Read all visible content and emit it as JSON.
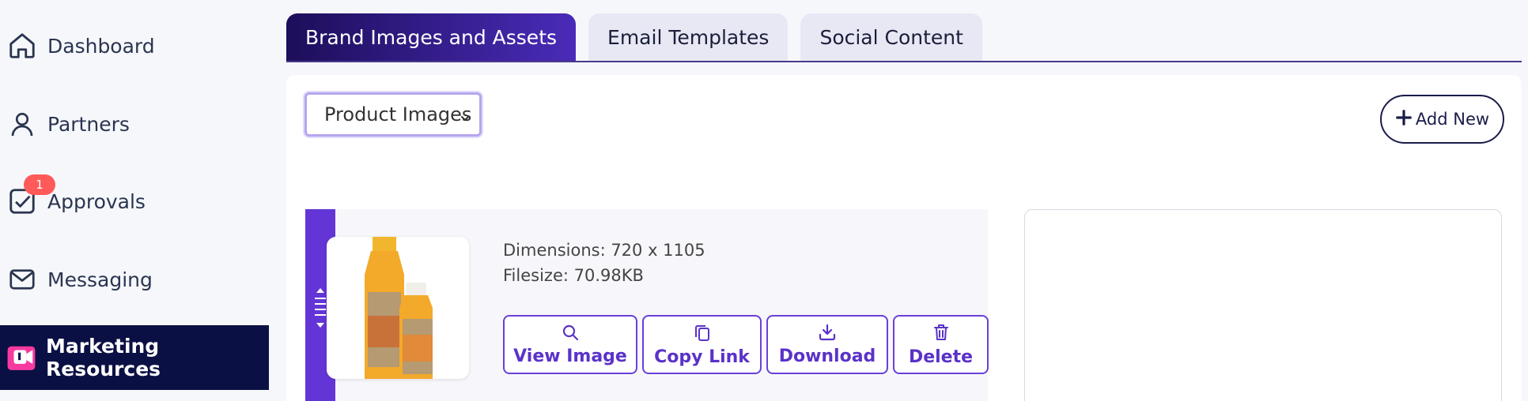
{
  "sidebar": {
    "items": [
      {
        "label": "Dashboard",
        "icon": "home-icon"
      },
      {
        "label": "Partners",
        "icon": "user-icon"
      },
      {
        "label": "Approvals",
        "icon": "checkbox-icon",
        "badge": "1"
      },
      {
        "label": "Messaging",
        "icon": "mail-icon"
      },
      {
        "label": "Marketing Resources",
        "icon": "marketing-icon",
        "active": true
      }
    ]
  },
  "tabs": [
    {
      "label": "Brand Images and Assets",
      "active": true
    },
    {
      "label": "Email Templates"
    },
    {
      "label": "Social Content"
    }
  ],
  "filter": {
    "selected": "Product Images"
  },
  "add_button": {
    "label": "Add New"
  },
  "asset": {
    "dimensions": "Dimensions: 720 x 1105",
    "filesize": "Filesize: 70.98KB",
    "actions": {
      "view": "View Image",
      "copy": "Copy Link",
      "download": "Download",
      "delete": "Delete"
    }
  },
  "colors": {
    "accent": "#6335d6",
    "nav_active": "#0b1044",
    "badge": "#ff5a5a"
  }
}
